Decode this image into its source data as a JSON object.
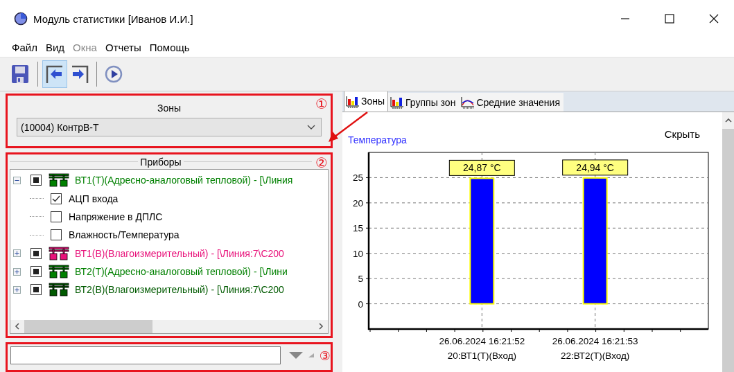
{
  "window": {
    "title": "Модуль статистики [Иванов И.И.]"
  },
  "menu": [
    {
      "label": "Файл",
      "disabled": false
    },
    {
      "label": "Вид",
      "disabled": false
    },
    {
      "label": "Окна",
      "disabled": true
    },
    {
      "label": "Отчеты",
      "disabled": false
    },
    {
      "label": "Помощь",
      "disabled": false
    }
  ],
  "toolbar": [
    {
      "kind": "save",
      "pressed": false
    },
    {
      "kind": "back",
      "pressed": true
    },
    {
      "kind": "forward",
      "pressed": false
    },
    {
      "kind": "play",
      "pressed": false
    }
  ],
  "zones": {
    "marker": "①",
    "title": "Зоны",
    "value": "(10004) КонтрВ-Т"
  },
  "devices": {
    "marker": "②",
    "title": "Приборы",
    "tree": [
      {
        "kind": "device",
        "label": "ВТ1(Т)(Адресно-аналоговый тепловой) - [\\Линия",
        "color": "#008000",
        "expanded": true,
        "checked": false,
        "partial": true,
        "children": [
          {
            "kind": "channel",
            "label": "АЦП входа",
            "checked": true,
            "partial": false
          },
          {
            "kind": "channel",
            "label": "Напряжение в ДПЛС",
            "checked": false,
            "partial": false
          },
          {
            "kind": "channel",
            "label": "Влажность/Температура",
            "checked": false,
            "partial": false
          }
        ]
      },
      {
        "kind": "device",
        "label": "ВТ1(В)(Влагоизмерительный) - [\\Линия:7\\С200",
        "color": "#e8127a",
        "expanded": false,
        "checked": false,
        "partial": true
      },
      {
        "kind": "device",
        "label": "ВТ2(Т)(Адресно-аналоговый тепловой) - [\\Лини",
        "color": "#008000",
        "expanded": false,
        "checked": false,
        "partial": true
      },
      {
        "kind": "device",
        "label": "ВТ2(В)(Влагоизмерительный) - [\\Линия:7\\С200",
        "color": "#005a00",
        "expanded": false,
        "checked": false,
        "partial": true
      }
    ]
  },
  "filter": {
    "marker": "③"
  },
  "tabs": [
    {
      "label": "Зоны",
      "kind": "bars",
      "selected": true
    },
    {
      "label": "Группы зон",
      "kind": "bars",
      "selected": false
    },
    {
      "label": "Средние значения",
      "kind": "curve",
      "selected": false
    }
  ],
  "chart_panel": {
    "hide_link": "Скрыть",
    "chart_data": {
      "type": "bar",
      "title": "Температура",
      "categories": [
        "26.06.2024 16:21:52\n20:ВТ1(Т)(Вход)",
        "26.06.2024 16:21:53\n22:ВТ2(Т)(Вход)"
      ],
      "series": [
        {
          "color": "#0000ff",
          "values": [
            24.87,
            24.94
          ]
        }
      ],
      "ylim": [
        -5,
        30
      ],
      "grid": true,
      "yticks": [
        0,
        5,
        10,
        15,
        20,
        25
      ],
      "value_labels": [
        "24,87 °C",
        "24,94 °C"
      ]
    }
  }
}
